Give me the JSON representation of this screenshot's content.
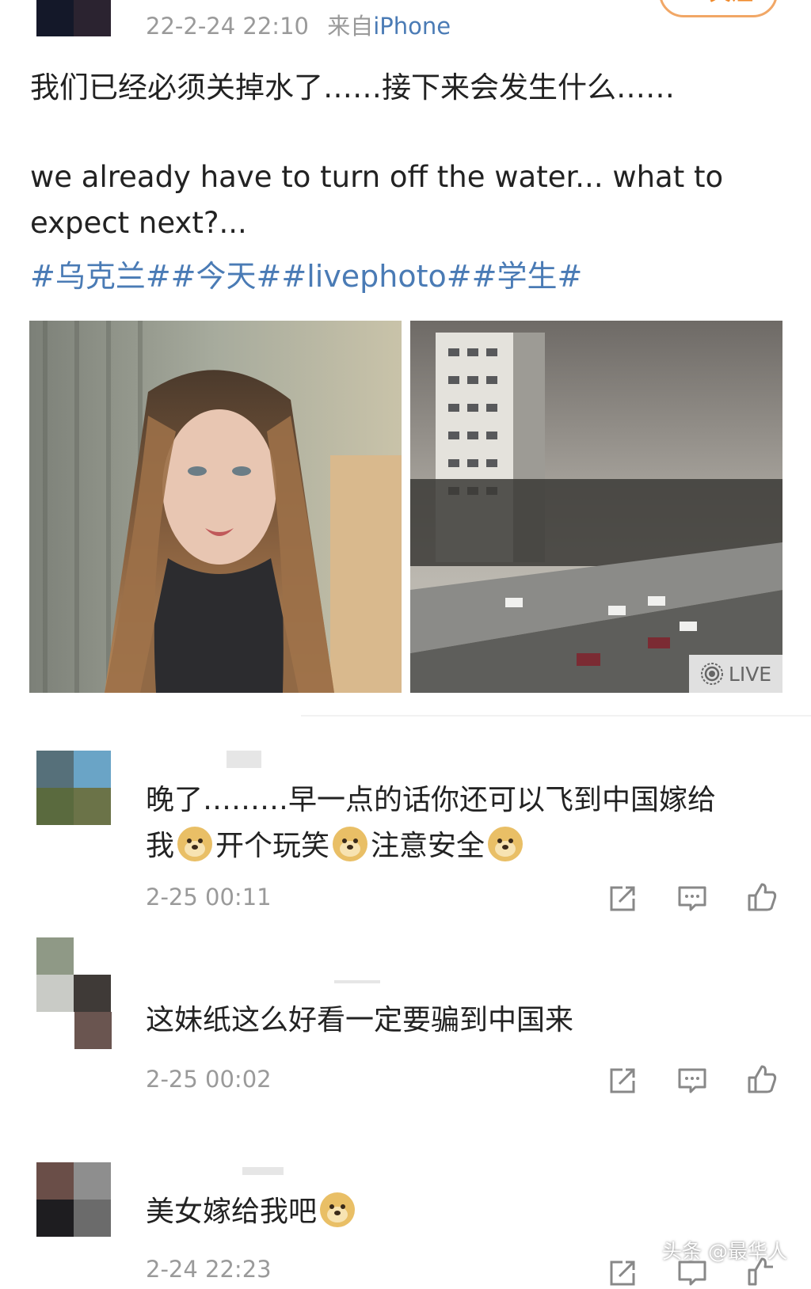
{
  "post": {
    "time": "22-2-24 22:10",
    "source_prefix": "来自",
    "source": "iPhone",
    "follow_label": "+ 关注",
    "text_zh": "我们已经必须关掉水了……接下来会发生什么……",
    "text_en_line1": "we already have to turn off the water... what to",
    "text_en_line2": "expect next?...",
    "hashtags": "#乌克兰##今天##livephoto##学生#",
    "live_label": "LIVE"
  },
  "comments": [
    {
      "text_line1": "晚了………早一点的话你还可以飞到中国嫁给",
      "text_line2_a": "我",
      "text_line2_b": "开个玩笑",
      "text_line2_c": "注意安全",
      "time": "2-25 00:11"
    },
    {
      "text": "这妹纸这么好看一定要骗到中国来",
      "time": "2-25 00:02"
    },
    {
      "text": "美女嫁给我吧",
      "time": "2-24 22:23"
    }
  ],
  "watermark": "头条 @最华人",
  "icons": {
    "share": "share-icon",
    "comment": "comment-icon",
    "like": "like-icon",
    "emoji": "doge-emoji-icon",
    "live": "live-photo-icon"
  },
  "colors": {
    "link": "#4a7bb5",
    "follow": "#f08a2b",
    "meta": "#9a9a9a"
  }
}
